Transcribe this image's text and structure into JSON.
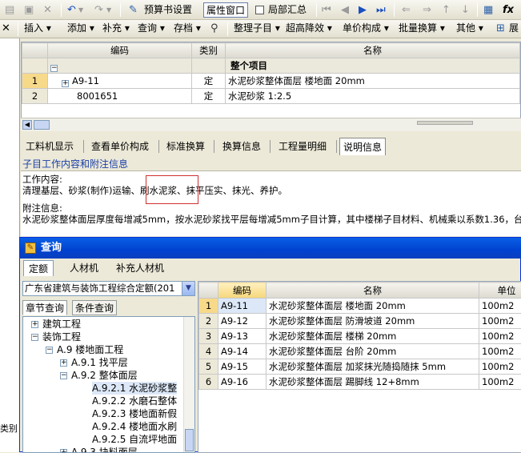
{
  "toolbar1": {
    "budget_settings": "预算书设置",
    "property_window": "属性窗口",
    "local_summary": "局部汇总"
  },
  "toolbar2": {
    "insert": "插入",
    "add": "添加",
    "supplement": "补充",
    "query": "查询",
    "archive": "存档",
    "organize_sub": "整理子目",
    "super_height": "超高降效",
    "unit_price": "单价构成",
    "batch_convert": "批量换算",
    "other": "其他",
    "expand": "展"
  },
  "main_grid": {
    "headers": [
      "编码",
      "类别",
      "名称"
    ],
    "group_label": "整个项目",
    "rows": [
      {
        "num": "1",
        "code": "A9-11",
        "type": "定",
        "name": "水泥砂浆整体面层 楼地面  20mm"
      },
      {
        "num": "2",
        "code": "8001651",
        "type": "定",
        "name": "水泥砂浆 1:2.5"
      }
    ]
  },
  "bottom_tabs": [
    "工料机显示",
    "查看单价构成",
    "标准换算",
    "换算信息",
    "工程量明细",
    "说明信息"
  ],
  "subtitle": "子目工作内容和附注信息",
  "description": {
    "work_label": "工作内容:",
    "work_text": "清理基层、砂浆(制作)运输、刷水泥浆、抹平压实、抹光、养护。",
    "note_label": "附注信息:",
    "note_text": "水泥砂浆整体面层厚度每增减5mm，按水泥砂浆找平层每增减5mm子目计算，其中楼梯子目材料、机械乘以系数1.36，台"
  },
  "query_window": {
    "title": "查询",
    "tabs": [
      "定额",
      "人材机",
      "补充人材机"
    ],
    "combo_value": "广东省建筑与装饰工程综合定额(201",
    "left_tabs": [
      "章节查询",
      "条件查询"
    ],
    "tree": [
      "建筑工程",
      "装饰工程",
      "A.9 楼地面工程",
      "A.9.1 找平层",
      "A.9.2 整体面层",
      "A.9.2.1 水泥砂浆整",
      "A.9.2.2 水磨石整体",
      "A.9.2.3 楼地面新假",
      "A.9.2.4 楼地面水刷",
      "A.9.2.5 自流坪地面",
      "A.9.3 块料面层"
    ],
    "grid_headers": [
      "编码",
      "名称",
      "单位"
    ],
    "grid_rows": [
      {
        "num": "1",
        "code": "A9-11",
        "name": "水泥砂浆整体面层 楼地面  20mm",
        "unit": "100m2"
      },
      {
        "num": "2",
        "code": "A9-12",
        "name": "水泥砂浆整体面层 防滑坡道  20mm",
        "unit": "100m2"
      },
      {
        "num": "3",
        "code": "A9-13",
        "name": "水泥砂浆整体面层 楼梯  20mm",
        "unit": "100m2"
      },
      {
        "num": "4",
        "code": "A9-14",
        "name": "水泥砂浆整体面层 台阶  20mm",
        "unit": "100m2"
      },
      {
        "num": "5",
        "code": "A9-15",
        "name": "水泥砂浆整体面层 加浆抹光随捣随抹  5mm",
        "unit": "100m2"
      },
      {
        "num": "6",
        "code": "A9-16",
        "name": "水泥砂浆整体面层 踢脚线  12+8mm",
        "unit": "100m2"
      }
    ]
  },
  "left_label": "类别"
}
